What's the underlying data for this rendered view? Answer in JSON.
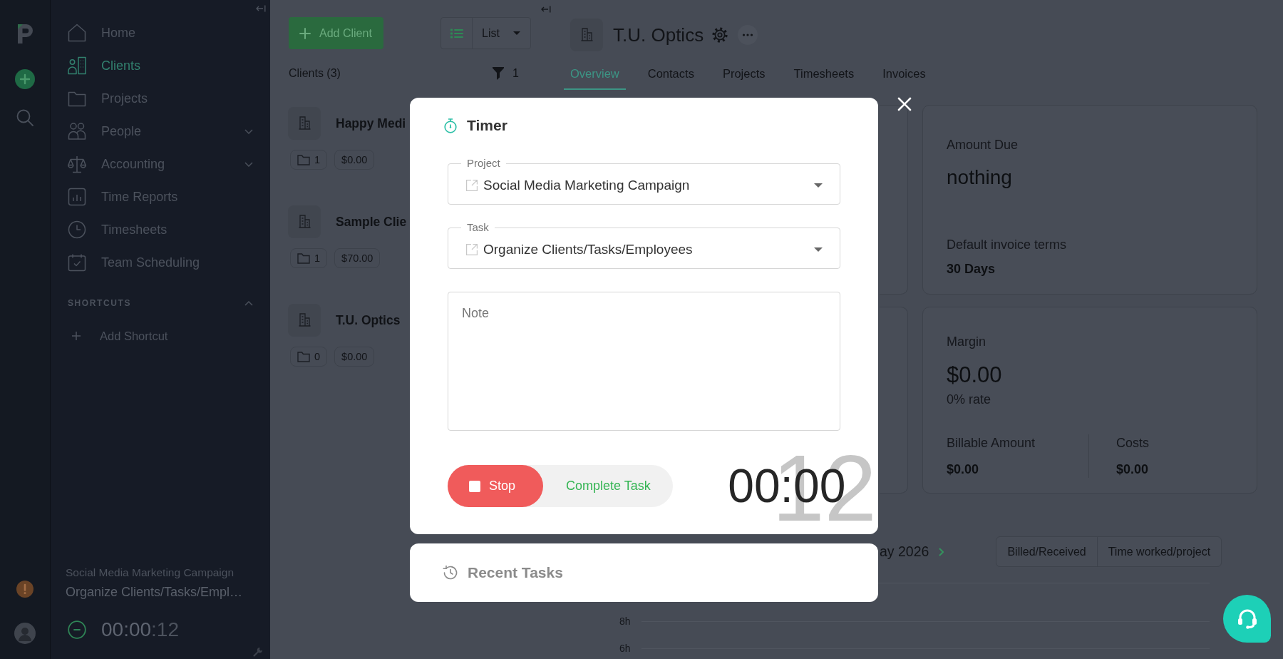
{
  "sidebar": {
    "items": [
      {
        "label": "Home",
        "kind": "link",
        "selected": false
      },
      {
        "label": "Clients",
        "kind": "link",
        "selected": true
      },
      {
        "label": "Projects",
        "kind": "link",
        "selected": false
      },
      {
        "label": "People",
        "kind": "group",
        "selected": false
      },
      {
        "label": "Accounting",
        "kind": "group",
        "selected": false
      },
      {
        "label": "Time Reports",
        "kind": "link",
        "selected": false
      },
      {
        "label": "Timesheets",
        "kind": "link",
        "selected": false
      },
      {
        "label": "Team Scheduling",
        "kind": "link",
        "selected": false
      }
    ],
    "shortcuts": {
      "title": "SHORTCUTS",
      "expanded": true,
      "add_label": "Add Shortcut"
    },
    "running_timer": {
      "project": "Social Media Marketing Campaign",
      "task": "Organize Clients/Tasks/Empl…",
      "time": "00:00",
      "seconds": ":12"
    }
  },
  "toolbar": {
    "add_button": "Add Client",
    "view": "List"
  },
  "client_list": {
    "title": "Clients (3)",
    "filter_count": "1",
    "clients": [
      {
        "name": "Happy Medi",
        "projects": "1",
        "amount": "$0.00"
      },
      {
        "name": "Sample Clie",
        "projects": "1",
        "amount": "$70.00"
      },
      {
        "name": "T.U. Optics",
        "projects": "0",
        "amount": "$0.00"
      }
    ]
  },
  "client": {
    "name": "T.U. Optics",
    "tabs": [
      {
        "label": "Overview",
        "selected": true
      },
      {
        "label": "Contacts",
        "selected": false
      },
      {
        "label": "Projects",
        "selected": false
      },
      {
        "label": "Timesheets",
        "selected": false
      },
      {
        "label": "Invoices",
        "selected": false
      }
    ],
    "amount_due": {
      "label": "Amount Due",
      "value": "nothing",
      "terms_label": "Default invoice terms",
      "terms": "30 Days"
    },
    "margin": {
      "label": "Margin",
      "value": "$0.00",
      "rate": "0% rate",
      "stats": [
        {
          "label": "Billable Amount",
          "value": "$0.00"
        },
        {
          "label": "Costs",
          "value": "$0.00"
        }
      ]
    },
    "chart": {
      "period": "ay 2026",
      "modes": [
        "Billed/Received",
        "Time worked/project"
      ],
      "y_labels": [
        "8h",
        "6h"
      ]
    }
  },
  "timer": {
    "title": "Timer",
    "fields": [
      {
        "label": "Project",
        "value": "Social Media Marketing Campaign"
      },
      {
        "label": "Task",
        "value": "Organize Clients/Tasks/Employees"
      }
    ],
    "note": {
      "placeholder": "Note"
    },
    "stop_button": "Stop",
    "complete_button": "Complete Task",
    "time": "00:00",
    "seconds": "12"
  },
  "recent_tasks": {
    "title": "Recent Tasks"
  }
}
